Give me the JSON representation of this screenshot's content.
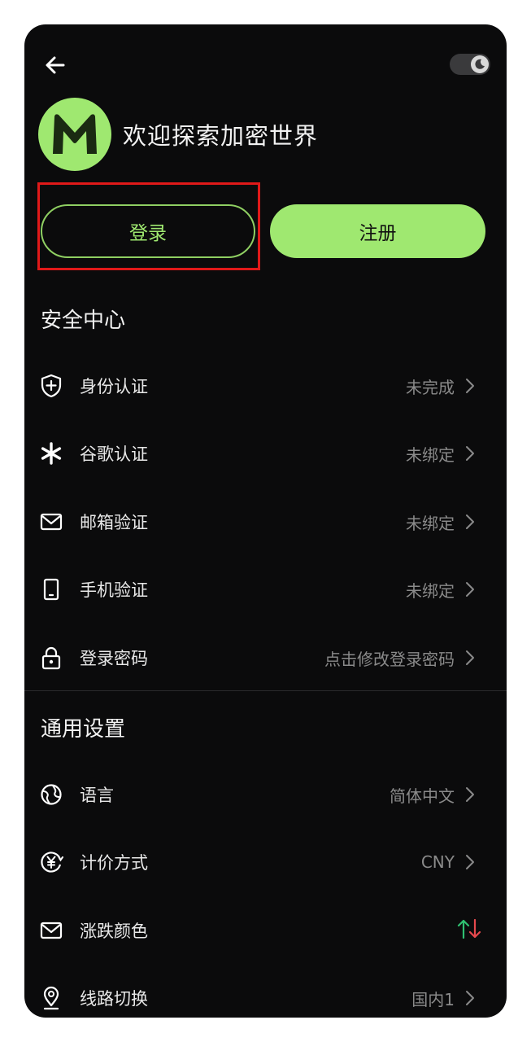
{
  "header": {
    "welcome": "欢迎探索加密世界"
  },
  "auth": {
    "login_label": "登录",
    "register_label": "注册"
  },
  "security": {
    "title": "安全中心",
    "items": [
      {
        "label": "身份认证",
        "value": "未完成",
        "icon": "shield-plus-icon"
      },
      {
        "label": "谷歌认证",
        "value": "未绑定",
        "icon": "asterisk-icon"
      },
      {
        "label": "邮箱验证",
        "value": "未绑定",
        "icon": "mail-icon"
      },
      {
        "label": "手机验证",
        "value": "未绑定",
        "icon": "phone-icon"
      },
      {
        "label": "登录密码",
        "value": "点击修改登录密码",
        "icon": "lock-icon"
      }
    ]
  },
  "general": {
    "title": "通用设置",
    "items": [
      {
        "label": "语言",
        "value": "简体中文",
        "icon": "globe-icon"
      },
      {
        "label": "计价方式",
        "value": "CNY",
        "icon": "currency-yen-icon"
      },
      {
        "label": "涨跌颜色",
        "value": "",
        "icon": "mail-icon"
      },
      {
        "label": "线路切换",
        "value": "国内1",
        "icon": "location-icon"
      }
    ]
  },
  "colors": {
    "accent": "#9fe870",
    "up": "#2fbf71",
    "down": "#e5484d",
    "highlight": "#e01919"
  }
}
